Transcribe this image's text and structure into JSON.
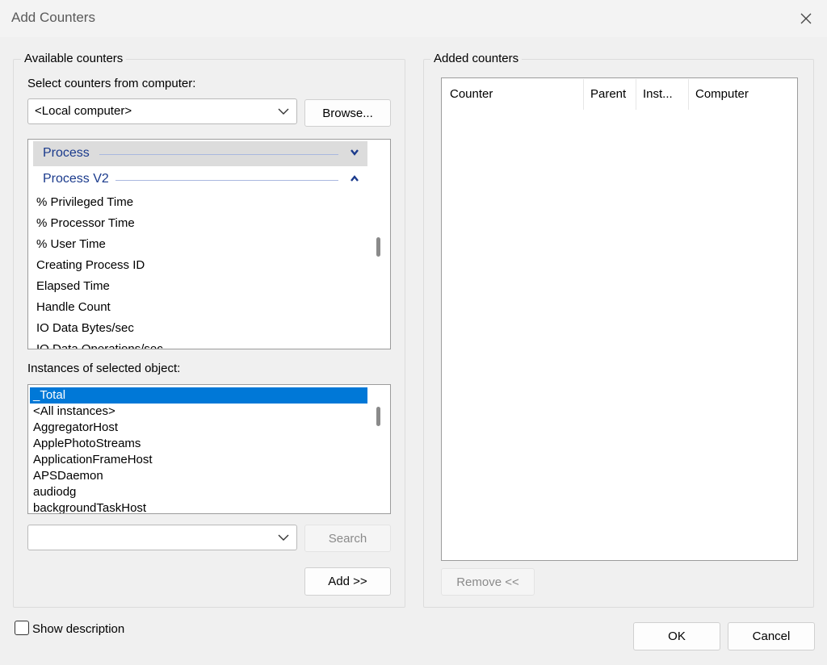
{
  "window": {
    "title": "Add Counters"
  },
  "available": {
    "group_label": "Available counters",
    "computer_label": "Select counters from computer:",
    "computer_value": "<Local computer>",
    "browse_label": "Browse...",
    "categories": [
      {
        "name": "Process",
        "expanded": false,
        "selected": true
      },
      {
        "name": "Process V2",
        "expanded": true,
        "selected": false
      }
    ],
    "counters": [
      "% Privileged Time",
      "% Processor Time",
      "% User Time",
      "Creating Process ID",
      "Elapsed Time",
      "Handle Count",
      "IO Data Bytes/sec",
      "IO Data Operations/sec"
    ],
    "instances_label": "Instances of selected object:",
    "instances": [
      "_Total",
      "<All instances>",
      "AggregatorHost",
      "ApplePhotoStreams",
      "ApplicationFrameHost",
      "APSDaemon",
      "audiodg",
      "backgroundTaskHost"
    ],
    "search_value": "",
    "search_label": "Search",
    "add_label": "Add >>"
  },
  "added": {
    "group_label": "Added counters",
    "columns": [
      "Counter",
      "Parent",
      "Inst...",
      "Computer"
    ],
    "remove_label": "Remove <<"
  },
  "footer": {
    "show_description_label": "Show description",
    "show_description_checked": false,
    "ok_label": "OK",
    "cancel_label": "Cancel"
  },
  "colors": {
    "selection": "#0078d7",
    "category_text": "#1a3a8c",
    "category_selected_bg": "#dcdcdc"
  }
}
